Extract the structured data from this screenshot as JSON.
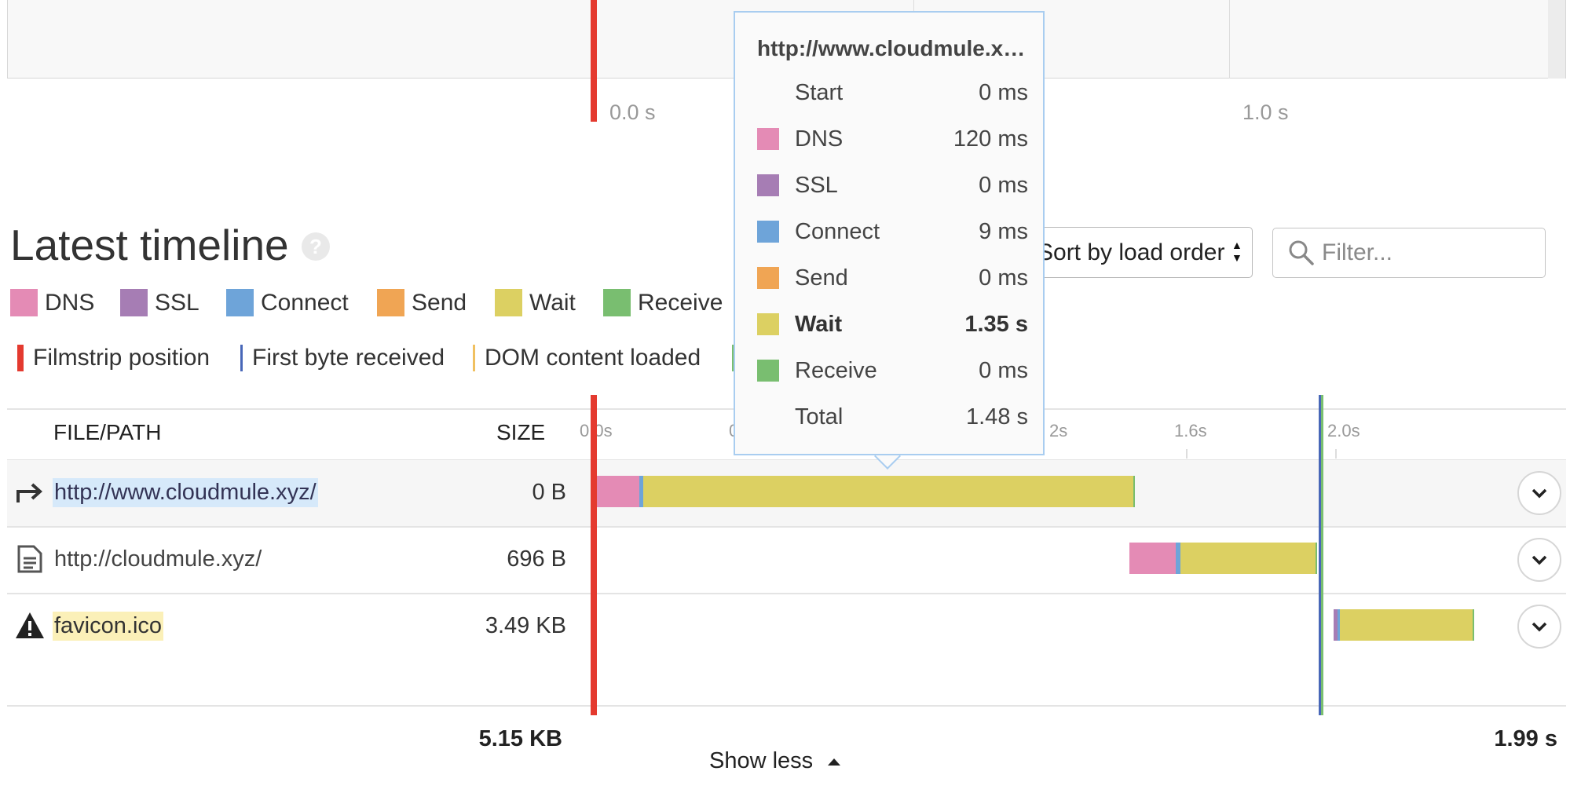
{
  "filmstrip": {
    "axis_labels": [
      "0.0 s",
      "1.0 s"
    ]
  },
  "section": {
    "title": "Latest timeline",
    "help_icon": "?"
  },
  "legend_phases": [
    {
      "label": "DNS",
      "color": "#e48bb5"
    },
    {
      "label": "SSL",
      "color": "#a67db4"
    },
    {
      "label": "Connect",
      "color": "#6ea4d9"
    },
    {
      "label": "Send",
      "color": "#f0a554"
    },
    {
      "label": "Wait",
      "color": "#dcd062"
    },
    {
      "label": "Receive",
      "color": "#79be70"
    }
  ],
  "legend_markers": [
    {
      "label": "Filmstrip position",
      "color": "#e43a2f"
    },
    {
      "label": "First byte received",
      "color": "#4867b8"
    },
    {
      "label": "DOM content loaded",
      "color": "#f0c060"
    }
  ],
  "controls": {
    "sort_label": "Sort by load order",
    "filter_placeholder": "Filter..."
  },
  "table": {
    "headers": {
      "file": "FILE/PATH",
      "size": "SIZE"
    },
    "ticks": [
      "0.0s",
      "0",
      "2s",
      "1.6s",
      "2.0s"
    ],
    "rows": [
      {
        "icon": "redirect-icon",
        "path": "http://www.cloudmule.xyz/",
        "size": "0 B"
      },
      {
        "icon": "document-icon",
        "path": "http://cloudmule.xyz/",
        "size": "696 B"
      },
      {
        "icon": "warning-icon",
        "path": "favicon.ico",
        "size": "3.49 KB"
      }
    ],
    "totals": {
      "size": "5.15 KB",
      "time": "1.99 s"
    },
    "show_less": "Show less"
  },
  "tooltip": {
    "title": "http://www.cloudmule.xyz/",
    "rows": [
      {
        "label": "Start",
        "value": "0 ms",
        "color": ""
      },
      {
        "label": "DNS",
        "value": "120 ms",
        "color": "#e48bb5"
      },
      {
        "label": "SSL",
        "value": "0 ms",
        "color": "#a67db4"
      },
      {
        "label": "Connect",
        "value": "9 ms",
        "color": "#6ea4d9"
      },
      {
        "label": "Send",
        "value": "0 ms",
        "color": "#f0a554"
      },
      {
        "label": "Wait",
        "value": "1.35 s",
        "color": "#dcd062"
      },
      {
        "label": "Receive",
        "value": "0 ms",
        "color": "#79be70"
      },
      {
        "label": "Total",
        "value": "1.48 s",
        "color": ""
      }
    ]
  }
}
